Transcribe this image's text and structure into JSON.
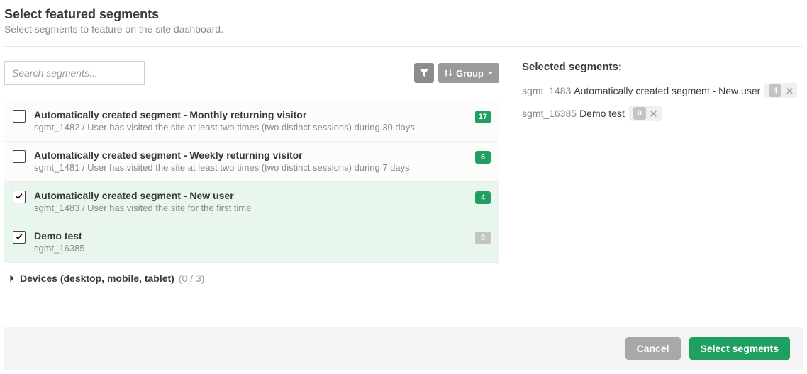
{
  "header": {
    "title": "Select featured segments",
    "subtitle": "Select segments to feature on the site dashboard."
  },
  "toolbar": {
    "search_placeholder": "Search segments...",
    "group_label": "Group"
  },
  "segments": [
    {
      "title": "Automatically created segment - Monthly returning visitor",
      "sub": "sgmt_1482 / User has visited the site at least two times (two distinct sessions) during 30 days",
      "count": "17",
      "count_color": "green",
      "selected": false
    },
    {
      "title": "Automatically created segment - Weekly returning visitor",
      "sub": "sgmt_1481 / User has visited the site at least two times (two distinct sessions) during 7 days",
      "count": "6",
      "count_color": "green",
      "selected": false
    },
    {
      "title": "Automatically created segment - New user",
      "sub": "sgmt_1483 / User has visited the site for the first time",
      "count": "4",
      "count_color": "green",
      "selected": true
    },
    {
      "title": "Demo test",
      "sub": "sgmt_16385",
      "count": "0",
      "count_color": "grey",
      "selected": true
    }
  ],
  "group_header": {
    "name": "Devices (desktop, mobile, tablet)",
    "count": "(0 / 3)"
  },
  "selected_panel": {
    "title": "Selected segments:",
    "items": [
      {
        "id": "sgmt_1483",
        "name": "Automatically created segment - New user",
        "count": "4"
      },
      {
        "id": "sgmt_16385",
        "name": "Demo test",
        "count": "0"
      }
    ]
  },
  "footer": {
    "cancel": "Cancel",
    "confirm": "Select segments"
  }
}
